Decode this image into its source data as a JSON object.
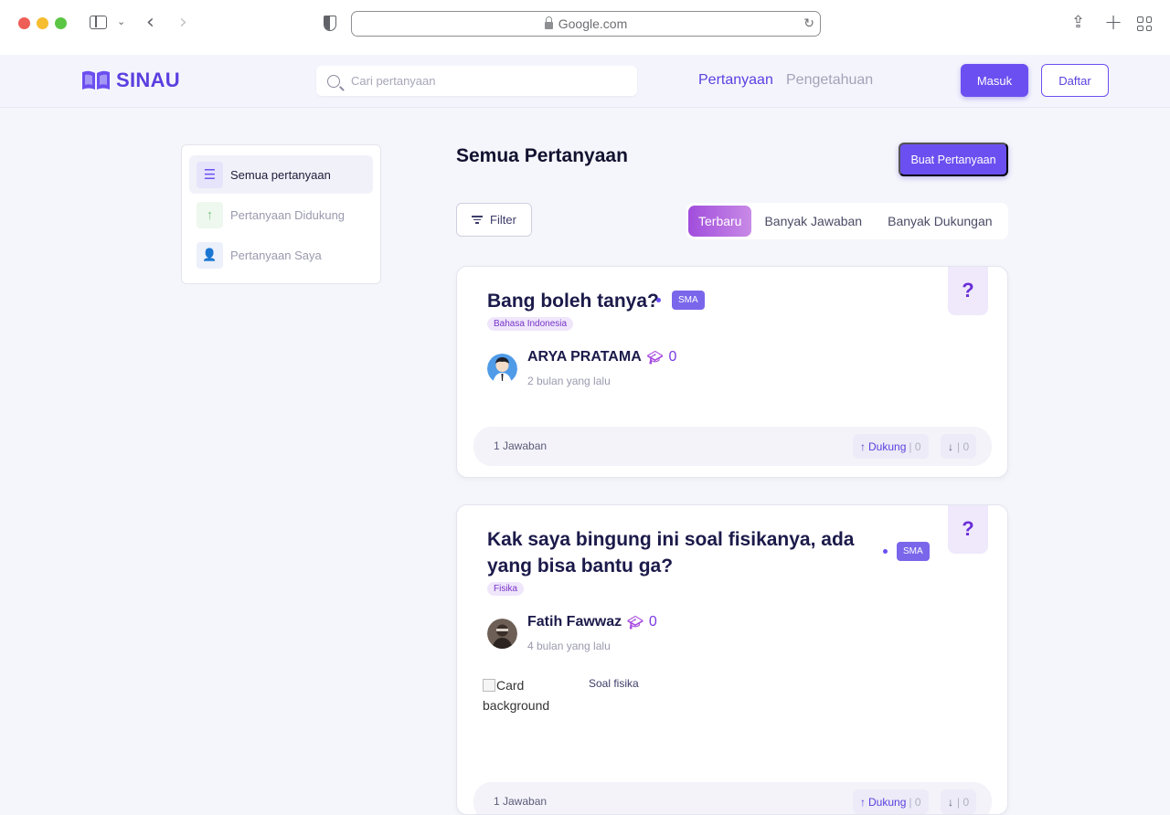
{
  "browser": {
    "url": "Google.com"
  },
  "header": {
    "brand": "SINAU",
    "search_placeholder": "Cari pertanyaan",
    "nav": [
      {
        "label": "Pertanyaan",
        "active": true
      },
      {
        "label": "Pengetahuan",
        "active": false
      }
    ],
    "login_label": "Masuk",
    "register_label": "Daftar"
  },
  "sidebar": {
    "items": [
      {
        "label": "Semua pertanyaan",
        "icon": "list-icon",
        "active": true
      },
      {
        "label": "Pertanyaan Didukung",
        "icon": "arrow-up-icon",
        "active": false
      },
      {
        "label": "Pertanyaan Saya",
        "icon": "user-list-icon",
        "active": false
      }
    ]
  },
  "main": {
    "title": "Semua Pertanyaan",
    "create_label": "Buat Pertanyaan",
    "filter_label": "Filter",
    "sort_tabs": [
      {
        "label": "Terbaru",
        "active": true
      },
      {
        "label": "Banyak Jawaban",
        "active": false
      },
      {
        "label": "Banyak Dukungan",
        "active": false
      }
    ]
  },
  "questions": [
    {
      "title": "Bang boleh tanya?",
      "level": "SMA",
      "subject": "Bahasa Indonesia",
      "author": "ARYA PRATAMA",
      "points": "0",
      "time": "2 bulan yang lalu",
      "answers": "1 Jawaban",
      "support_label": "Dukung",
      "support_count": "| 0",
      "down_count": "| 0",
      "badge": "?"
    },
    {
      "title_line1": "Kak saya bingung ini soal fisikanya, ada",
      "title_line2": "yang bisa bantu ga?",
      "level": "SMA",
      "subject": "Fisika",
      "author": "Fatih Fawwaz",
      "points": "0",
      "time": "4 bulan yang lalu",
      "image_alt_line1": "Card",
      "image_alt_line2": "background",
      "attachment_caption": "Soal fisika",
      "answers": "1 Jawaban",
      "support_label": "Dukung",
      "support_count": "| 0",
      "down_count": "| 0",
      "badge": "?"
    }
  ],
  "colors": {
    "primary": "#6c4ff0",
    "brand": "#5b3fe0",
    "accent_gradient_start": "#a14ddc",
    "background": "#f5f6fb"
  }
}
